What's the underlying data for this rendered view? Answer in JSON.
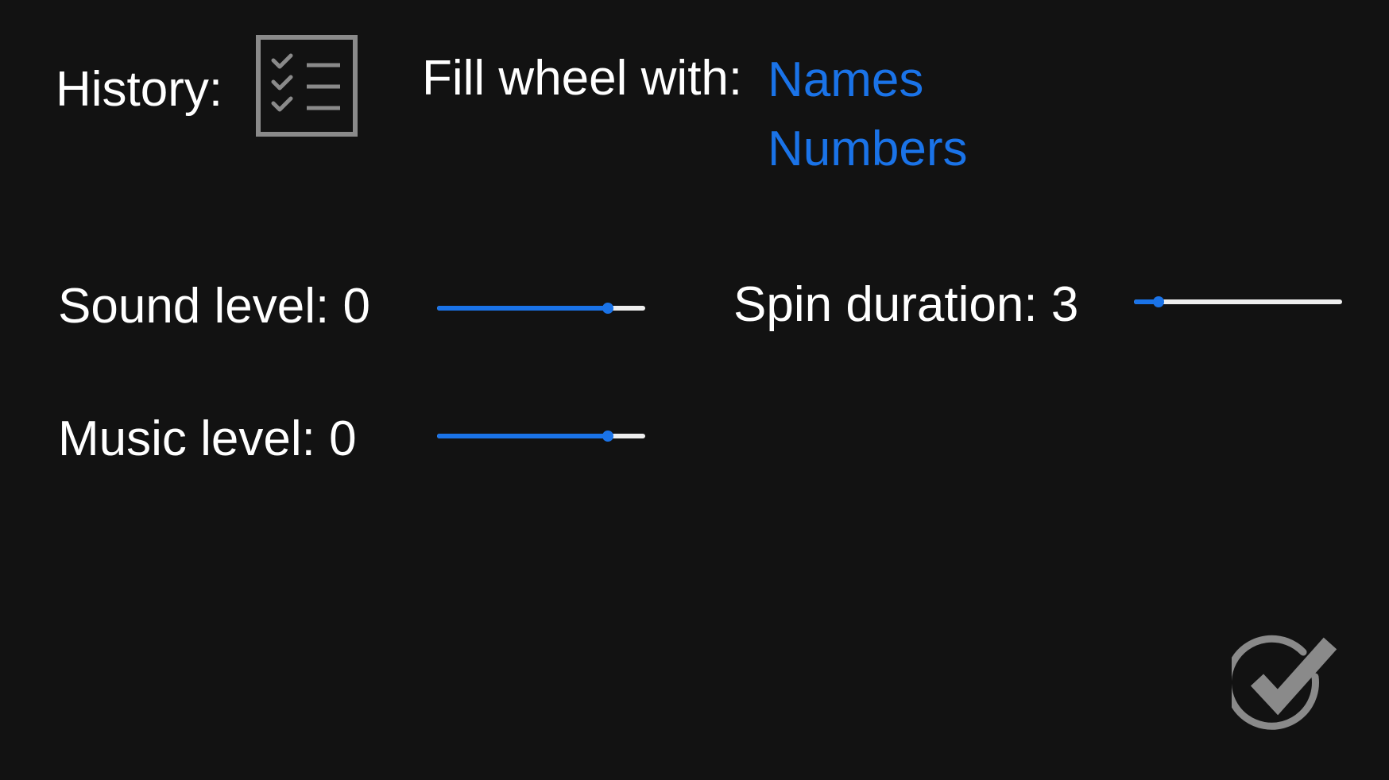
{
  "history": {
    "label": "History:",
    "icon": "checklist-icon"
  },
  "fill_wheel": {
    "label": "Fill wheel with:",
    "options": [
      "Names",
      "Numbers"
    ]
  },
  "sound": {
    "label": "Sound level: 0",
    "value_fraction": 0.82
  },
  "music": {
    "label": "Music level: 0",
    "value_fraction": 0.82
  },
  "spin": {
    "label": "Spin duration: 3",
    "value_fraction": 0.12
  },
  "confirm": {
    "icon": "checkmark-circle-icon"
  },
  "colors": {
    "background": "#121212",
    "text": "#ffffff",
    "accent": "#1a73e8",
    "icon_gray": "#8a8a8a",
    "track": "#eeeeee"
  }
}
